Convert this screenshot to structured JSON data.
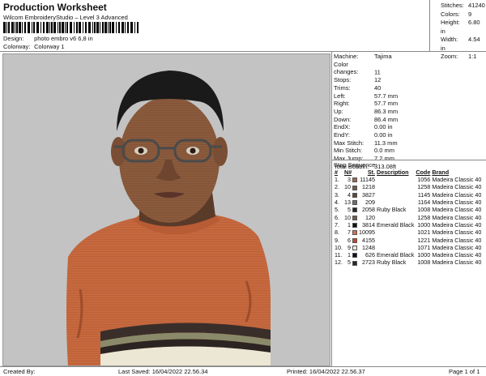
{
  "header": {
    "title": "Production Worksheet",
    "software": "Wilcom EmbroideryStudio – Level 3 Advanced",
    "design_label": "Design:",
    "design_value": "photo embro v6 6,8 in",
    "colorway_label": "Colorway:",
    "colorway_value": "Colorway 1"
  },
  "stats": [
    {
      "label": "Stitches:",
      "value": "41240"
    },
    {
      "label": "Colors:",
      "value": "9"
    },
    {
      "label": "Height:",
      "value": "6.80 in"
    },
    {
      "label": "Width:",
      "value": "4.54 in"
    },
    {
      "label": "Zoom:",
      "value": "1:1"
    }
  ],
  "machine_info": [
    {
      "label": "Machine:",
      "value": "Tajima"
    },
    {
      "label": "Color changes:",
      "value": "11"
    },
    {
      "label": "Stops:",
      "value": "12"
    },
    {
      "label": "Trims:",
      "value": "40"
    },
    {
      "label": "Left:",
      "value": "57.7 mm"
    },
    {
      "label": "Right:",
      "value": "57.7 mm"
    },
    {
      "label": "Up:",
      "value": "86.3 mm"
    },
    {
      "label": "Down:",
      "value": "86.4 mm"
    },
    {
      "label": "EndX:",
      "value": "0.00 in"
    },
    {
      "label": "EndY:",
      "value": "0.00 in"
    },
    {
      "label": "Max Stitch:",
      "value": "11.3 mm"
    },
    {
      "label": "Min Stitch:",
      "value": "0.0 mm"
    },
    {
      "label": "Max Jump:",
      "value": "7.2 mm"
    },
    {
      "label": "Total Bobbin:",
      "value": "313.08ft"
    }
  ],
  "stop_sequence": {
    "title": "Stop Sequence:",
    "headers": [
      "#",
      "N#",
      "St.",
      "Description",
      "Code",
      "Brand"
    ],
    "rows": [
      {
        "n": "1.",
        "needle": "3",
        "color": "#a0694a",
        "st": "11145",
        "desc": "",
        "code": "1056",
        "brand": "Madeira Classic 40"
      },
      {
        "n": "2.",
        "needle": "10",
        "color": "#7a5a44",
        "st": "1218",
        "desc": "",
        "code": "1258",
        "brand": "Madeira Classic 40"
      },
      {
        "n": "3.",
        "needle": "4",
        "color": "#5e4636",
        "st": "3827",
        "desc": "",
        "code": "1145",
        "brand": "Madeira Classic 40"
      },
      {
        "n": "4.",
        "needle": "13",
        "color": "#6e6e6e",
        "st": "209",
        "desc": "",
        "code": "1164",
        "brand": "Madeira Classic 40"
      },
      {
        "n": "5.",
        "needle": "5",
        "color": "#2c2422",
        "st": "2058",
        "desc": "Ruby Black",
        "code": "1008",
        "brand": "Madeira Classic 40"
      },
      {
        "n": "6.",
        "needle": "10",
        "color": "#7a5a44",
        "st": "120",
        "desc": "",
        "code": "1258",
        "brand": "Madeira Classic 40"
      },
      {
        "n": "7.",
        "needle": "1",
        "color": "#111111",
        "st": "3814",
        "desc": "Emerald Black",
        "code": "1000",
        "brand": "Madeira Classic 40"
      },
      {
        "n": "8.",
        "needle": "7",
        "color": "#d8704a",
        "st": "10095",
        "desc": "",
        "code": "1021",
        "brand": "Madeira Classic 40"
      },
      {
        "n": "9.",
        "needle": "6",
        "color": "#c04a2c",
        "st": "4155",
        "desc": "",
        "code": "1221",
        "brand": "Madeira Classic 40"
      },
      {
        "n": "10.",
        "needle": "9",
        "color": "#ece6d4",
        "st": "1248",
        "desc": "",
        "code": "1071",
        "brand": "Madeira Classic 40"
      },
      {
        "n": "11.",
        "needle": "1",
        "color": "#111111",
        "st": "626",
        "desc": "Emerald Black",
        "code": "1000",
        "brand": "Madeira Classic 40"
      },
      {
        "n": "12.",
        "needle": "5",
        "color": "#2c2422",
        "st": "2723",
        "desc": "Ruby Black",
        "code": "1008",
        "brand": "Madeira Classic 40"
      }
    ]
  },
  "footer": {
    "created_by": "Created By:",
    "last_saved": "Last Saved: 16/04/2022 22.56.34",
    "printed": "Printed: 16/04/2022 22.56.37",
    "page": "Page 1 of 1"
  },
  "colors": {
    "panel_bg": "#c3c3c3",
    "sweater": "#c7683e",
    "skin": "#8a5a3c",
    "hair": "#1a1a1a"
  }
}
